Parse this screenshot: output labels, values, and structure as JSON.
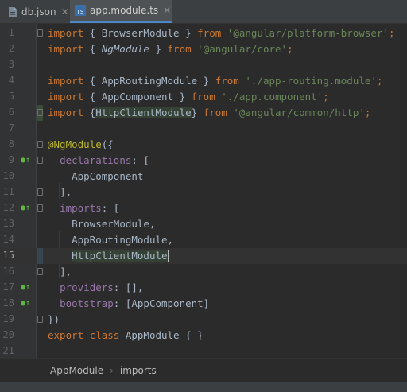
{
  "tabs": [
    {
      "label": "db.json",
      "icon": "json-file-icon",
      "active": false
    },
    {
      "label": "app.module.ts",
      "icon": "typescript-file-icon",
      "icon_text": "TS",
      "active": true
    }
  ],
  "colors": {
    "keyword": "#cc7832",
    "string": "#6a8759",
    "annotation": "#bbb529",
    "property": "#9876aa",
    "text": "#a9b7c6",
    "background": "#2b2b2b"
  },
  "lines": [
    {
      "n": "1"
    },
    {
      "n": "2"
    },
    {
      "n": "3"
    },
    {
      "n": "4"
    },
    {
      "n": "5"
    },
    {
      "n": "6"
    },
    {
      "n": "7"
    },
    {
      "n": "8"
    },
    {
      "n": "9"
    },
    {
      "n": "10"
    },
    {
      "n": "11"
    },
    {
      "n": "12"
    },
    {
      "n": "13"
    },
    {
      "n": "14"
    },
    {
      "n": "15"
    },
    {
      "n": "16"
    },
    {
      "n": "17"
    },
    {
      "n": "18"
    },
    {
      "n": "19"
    },
    {
      "n": "20"
    },
    {
      "n": "21"
    }
  ],
  "code": {
    "l1": {
      "kw1": "import",
      "mid": " { BrowserModule } ",
      "kw2": "from",
      "str": " '@angular/platform-browser'",
      "end": ";"
    },
    "l2": {
      "kw1": "import",
      "a": " { ",
      "name": "NgModule",
      "b": " } ",
      "kw2": "from",
      "str": " '@angular/core'",
      "end": ";"
    },
    "l4": {
      "kw1": "import",
      "mid": " { AppRoutingModule } ",
      "kw2": "from",
      "str": " './app-routing.module'",
      "end": ";"
    },
    "l5": {
      "kw1": "import",
      "mid": " { AppComponent } ",
      "kw2": "from",
      "str": " './app.component'",
      "end": ";"
    },
    "l6": {
      "kw1": "import",
      "a": " {",
      "name": "HttpClientModule",
      "b": "} ",
      "kw2": "from",
      "str": " '@angular/common/http'",
      "end": ";"
    },
    "l8": {
      "ann": "@NgModule",
      "rest": "({"
    },
    "l9": {
      "prop": "declarations",
      "rest": ": ["
    },
    "l10": {
      "text": "AppComponent"
    },
    "l11": {
      "text": "],"
    },
    "l12": {
      "prop": "imports",
      "rest": ": ["
    },
    "l13": {
      "text": "BrowserModule,"
    },
    "l14": {
      "text": "AppRoutingModule,"
    },
    "l15": {
      "text": "HttpClientModule"
    },
    "l16": {
      "text": "],"
    },
    "l17": {
      "prop": "providers",
      "rest": ": [],"
    },
    "l18": {
      "prop": "bootstrap",
      "rest": ": [AppComponent]"
    },
    "l19": {
      "text": "})"
    },
    "l20": {
      "kw1": "export",
      "kw2": "class",
      "rest": " AppModule { }"
    }
  },
  "breadcrumb": [
    "AppModule",
    "imports"
  ]
}
